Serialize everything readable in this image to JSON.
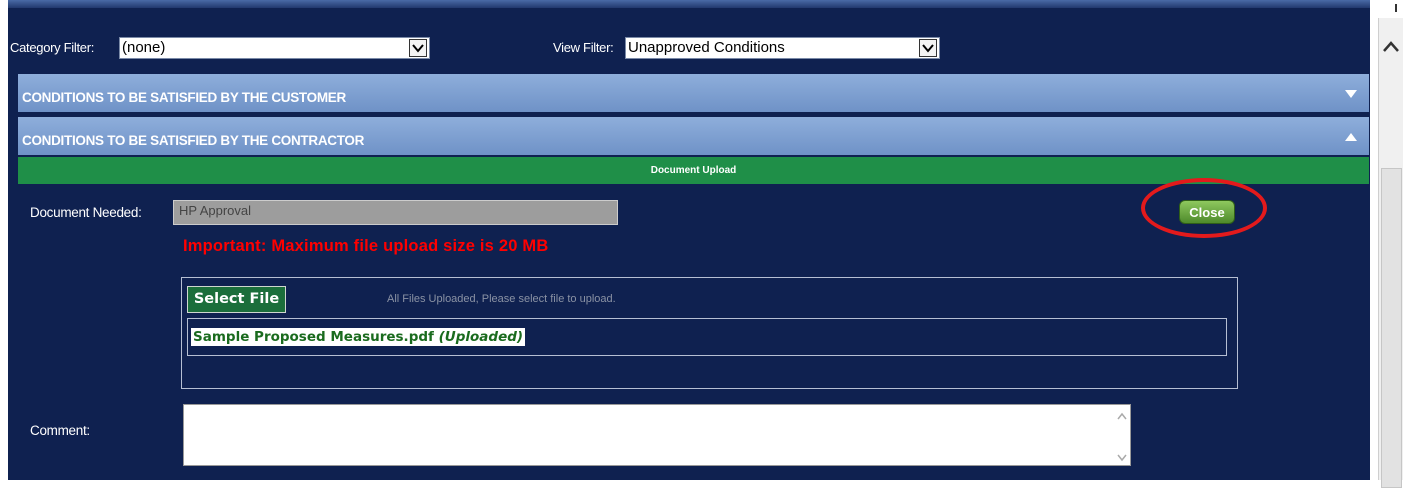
{
  "filters": {
    "category_label": "Category Filter:",
    "category_value": "(none)",
    "view_label": "View Filter:",
    "view_value": "Unapproved Conditions"
  },
  "panels": [
    {
      "title": "CONDITIONS TO BE SATISFIED BY THE CUSTOMER",
      "state": "collapsed"
    },
    {
      "title": "CONDITIONS TO BE SATISFIED BY THE CONTRACTOR",
      "state": "expanded"
    }
  ],
  "upload_section": {
    "header": "Document Upload",
    "document_needed_label": "Document Needed:",
    "document_needed_value": "HP Approval",
    "close_label": "Close",
    "warning": "Important: Maximum file upload size is 20 MB",
    "select_file_label": "Select File",
    "hint": "All Files Uploaded, Please select file to upload.",
    "file_name": "Sample Proposed Measures.pdf",
    "file_status": "(Uploaded)",
    "comment_label": "Comment:"
  },
  "colors": {
    "background": "#0f2150",
    "panel_header": "#7c9dd0",
    "green_bar": "#1f8f48",
    "warning": "#ff0000",
    "highlight_circle": "#e31a1c"
  },
  "icons": {
    "dropdown": "chevron-down-icon",
    "collapsed": "triangle-down-icon",
    "expanded": "triangle-up-icon",
    "scroll_up": "chevron-up-icon"
  }
}
